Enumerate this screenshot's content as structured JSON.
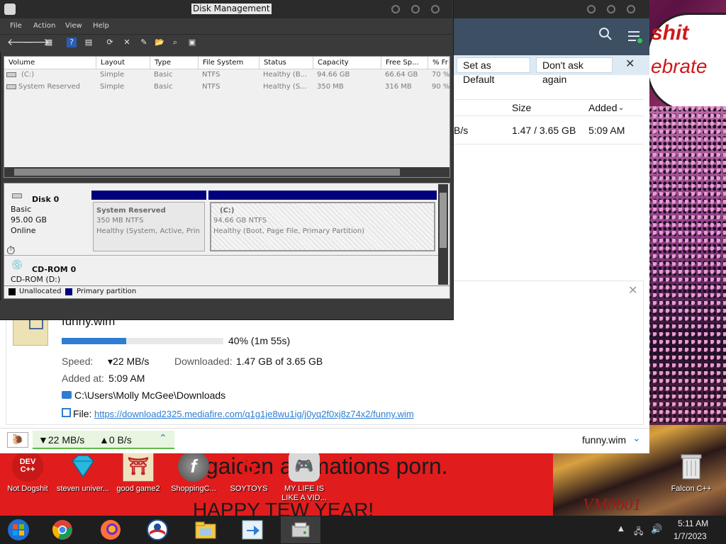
{
  "wallpaper": {
    "speech_text_1": "shit",
    "speech_text_2": "ebrate",
    "band_text_1": "gaiden animations porn.",
    "band_text_2": "HAPPY TEW YEAR!",
    "corner_text": "VM0b01"
  },
  "desktop_icons": [
    {
      "label": "Not Dogshit",
      "icon": "devcpp-icon"
    },
    {
      "label": "steven univer...",
      "icon": "diamond-icon"
    },
    {
      "label": "good game2",
      "icon": "torii-icon"
    },
    {
      "label": "ShoppingC...",
      "icon": "flash-icon"
    },
    {
      "label": "SOYTOYS",
      "icon": "s-logo-icon"
    },
    {
      "label": "MY LIFE IS LIKE A VID...",
      "icon": "gamepad-icon"
    },
    {
      "label": "Falcon C++",
      "icon": "recycle-bin-icon"
    }
  ],
  "download_manager": {
    "info_bar": {
      "set_default": "Set as Default",
      "dont_ask": "Don't ask again",
      "close": "✕"
    },
    "table": {
      "col_size": "Size",
      "col_added": "Added",
      "row_speed_fragment": "B/s",
      "row_size": "1.47 / 3.65 GB",
      "row_added": "5:09 AM"
    },
    "details": {
      "close": "✕",
      "file_name": "funny.wim",
      "progress_fraction": 0.4,
      "progress_text": "40%  (1m 55s)",
      "speed_label": "Speed:",
      "speed_value": "▾22 MB/s",
      "downloaded_label": "Downloaded:",
      "downloaded_value": "1.47 GB of 3.65 GB",
      "added_label": "Added at:",
      "added_value": "5:09 AM",
      "path": "C:\\Users\\Molly McGee\\Downloads",
      "file_label": "File:",
      "file_url": "https://download2325.mediafire.com/q1g1je8wu1ig/j0yq2f0xj8z74x2/funny.wim"
    },
    "status": {
      "down": "▼22 MB/s",
      "up": "▲0 B/s",
      "file": "funny.wim"
    },
    "colors": {
      "accent": "#2d7dd2",
      "header": "#3c4f63",
      "status_green": "#63b84a"
    }
  },
  "disk_management": {
    "title": "Disk Management",
    "menu": [
      "File",
      "Action",
      "View",
      "Help"
    ],
    "columns": [
      "Volume",
      "Layout",
      "Type",
      "File System",
      "Status",
      "Capacity",
      "Free Sp...",
      "% Fr"
    ],
    "rows": [
      {
        "volume": "(C:)",
        "layout": "Simple",
        "type": "Basic",
        "fs": "NTFS",
        "status": "Healthy (B...",
        "capacity": "94.66 GB",
        "free": "66.64 GB",
        "pct": "70 %"
      },
      {
        "volume": "System Reserved",
        "layout": "Simple",
        "type": "Basic",
        "fs": "NTFS",
        "status": "Healthy (S...",
        "capacity": "350 MB",
        "free": "316 MB",
        "pct": "90 %"
      }
    ],
    "disk0": {
      "name": "Disk 0",
      "kind": "Basic",
      "size": "95.00 GB",
      "state": "Online",
      "partitions": [
        {
          "title": "System Reserved",
          "size": "350 MB NTFS",
          "status": "Healthy (System, Active, Prin"
        },
        {
          "title": "(C:)",
          "size": "94.66 GB NTFS",
          "status": "Healthy (Boot, Page File, Primary Partition)"
        }
      ]
    },
    "cdrom": {
      "name": "CD-ROM 0",
      "label": "CD-ROM (D:)"
    },
    "legend": [
      {
        "label": "Unallocated",
        "color": "#000000"
      },
      {
        "label": "Primary partition",
        "color": "#00007f"
      }
    ]
  },
  "taskbar": {
    "time": "5:11 AM",
    "date": "1/7/2023"
  }
}
